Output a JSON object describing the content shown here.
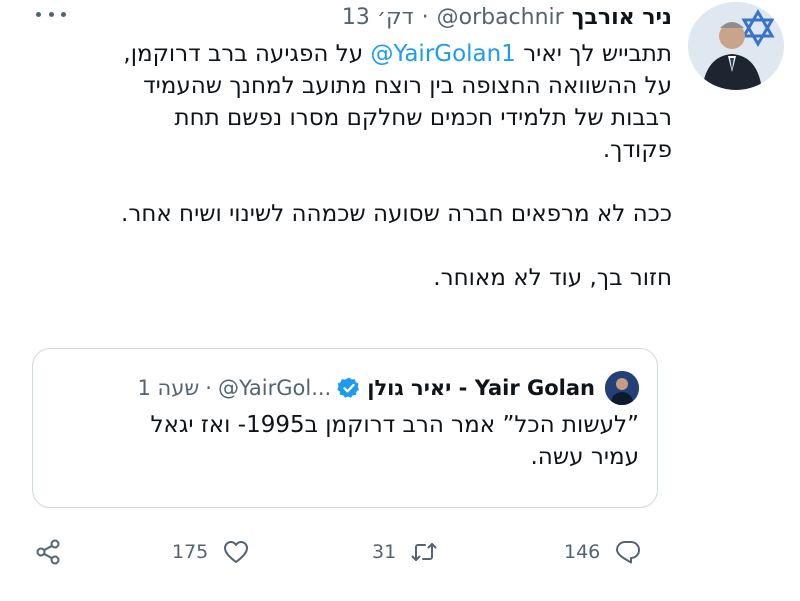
{
  "tweet": {
    "author_name": "ניר אורבך",
    "handle": "@orbachnir",
    "separator": "·",
    "time": "13 דק׳",
    "body": {
      "line1_prefix": "תתבייש לך יאיר",
      "mention": "@YairGolan1",
      "line1_suffix": "על הפגיעה ברב דרוקמן,",
      "line2": "על ההשוואה החצופה בין רוצח מתועב למחנך שהעמיד",
      "line3": "רבבות של תלמידי חכמים שחלקם מסרו נפשם תחת",
      "line4": "פקודך.",
      "paragraph2": "ככה לא מרפאים חברה שסועה שכמהה לשינוי ושיח אחר.",
      "paragraph3": "חזור בך, עוד לא מאוחר."
    }
  },
  "quote": {
    "name": "יאיר גולן - Yair Golan",
    "handle": "@YairGol...",
    "separator": "·",
    "time": "שעה 1",
    "line1": "”לעשות הכל” אמר הרב דרוקמן ב1995- ואז יגאל",
    "line2": "עמיר עשה."
  },
  "actions": {
    "reply_count": "146",
    "retweet_count": "31",
    "like_count": "175"
  },
  "colors": {
    "accent": "#1d9bf0",
    "text": "#0f1419",
    "secondary": "#536471",
    "border": "#cfd9de"
  },
  "icons": [
    "more-options-icon",
    "verified-badge-icon",
    "reply-icon",
    "retweet-icon",
    "like-icon",
    "share-icon"
  ]
}
